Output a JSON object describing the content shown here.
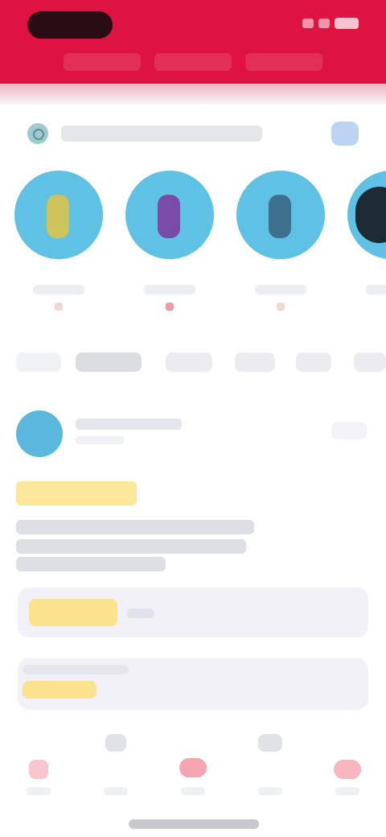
{
  "app": {
    "brand_color": "#de1341",
    "accent_color": "#5fc1e4",
    "highlight_color": "#fbe28c"
  },
  "status_bar": {
    "icons": [
      "signal-icon",
      "wifi-icon",
      "battery-icon"
    ]
  },
  "header": {
    "tabs": [
      "",
      "",
      ""
    ]
  },
  "search": {
    "placeholder": "",
    "icon": "search-icon",
    "action_icon": "notification-icon"
  },
  "stories": [
    {
      "name": "",
      "figure_color": "#cfc45c"
    },
    {
      "name": "",
      "figure_color": "#7a4aa8"
    },
    {
      "name": "",
      "figure_color": "#3f6f8f"
    },
    {
      "name": "",
      "figure_color": "#1c2b33"
    }
  ],
  "chips": [
    "",
    "",
    "",
    "",
    "",
    ""
  ],
  "post": {
    "author": "",
    "time": "",
    "follow_label": "",
    "tag": "",
    "lines": [
      "",
      "",
      ""
    ],
    "cards": [
      {
        "highlight": "",
        "label": ""
      },
      {
        "highlight": "",
        "label": ""
      }
    ]
  },
  "bottom_nav": {
    "items": [
      {
        "label": "",
        "icon": "home-icon",
        "active": true
      },
      {
        "label": "",
        "icon": "discover-icon",
        "active": false
      },
      {
        "label": "",
        "icon": "create-icon",
        "active": false
      },
      {
        "label": "",
        "icon": "messages-icon",
        "active": false
      },
      {
        "label": "",
        "icon": "profile-icon",
        "active": false
      }
    ]
  }
}
